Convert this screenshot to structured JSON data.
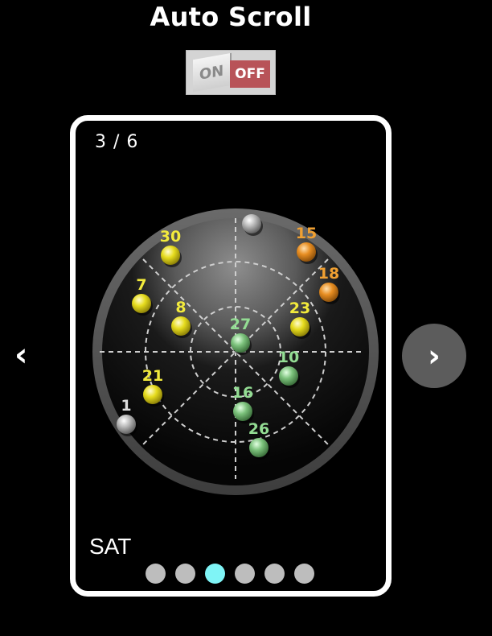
{
  "header": {
    "title": "Auto Scroll"
  },
  "toggle": {
    "on_label": "ON",
    "off_label": "OFF"
  },
  "slide": {
    "counter": "3 / 6",
    "caption": "SAT"
  },
  "nav": {
    "prev_icon": "‹",
    "next_icon": "›"
  },
  "pager": {
    "count": 6,
    "active_index": 2
  },
  "skyplot": {
    "satellites": [
      {
        "id": "30",
        "color": "yellow",
        "label_color": "#f2ea3c"
      },
      {
        "id": "7",
        "color": "yellow",
        "label_color": "#f2ea3c"
      },
      {
        "id": "8",
        "color": "yellow",
        "label_color": "#f2ea3c"
      },
      {
        "id": "21",
        "color": "yellow",
        "label_color": "#f2ea3c"
      },
      {
        "id": "23",
        "color": "yellow",
        "label_color": "#f2ea3c"
      },
      {
        "id": "15",
        "color": "orange",
        "label_color": "#f0a032"
      },
      {
        "id": "18",
        "color": "orange",
        "label_color": "#f0a032"
      },
      {
        "id": "27",
        "color": "green",
        "label_color": "#93dc93"
      },
      {
        "id": "10",
        "color": "green",
        "label_color": "#93dc93"
      },
      {
        "id": "16",
        "color": "green",
        "label_color": "#93dc93"
      },
      {
        "id": "26",
        "color": "green",
        "label_color": "#93dc93"
      },
      {
        "id": "1",
        "color": "gray",
        "label_color": "#dddddd"
      },
      {
        "id": "",
        "color": "gray",
        "label_color": "#dddddd"
      }
    ],
    "colors": {
      "yellow": "#e6dc1e",
      "orange": "#e88e22",
      "green": "#7cc27c",
      "gray": "#b9b9b9"
    }
  }
}
